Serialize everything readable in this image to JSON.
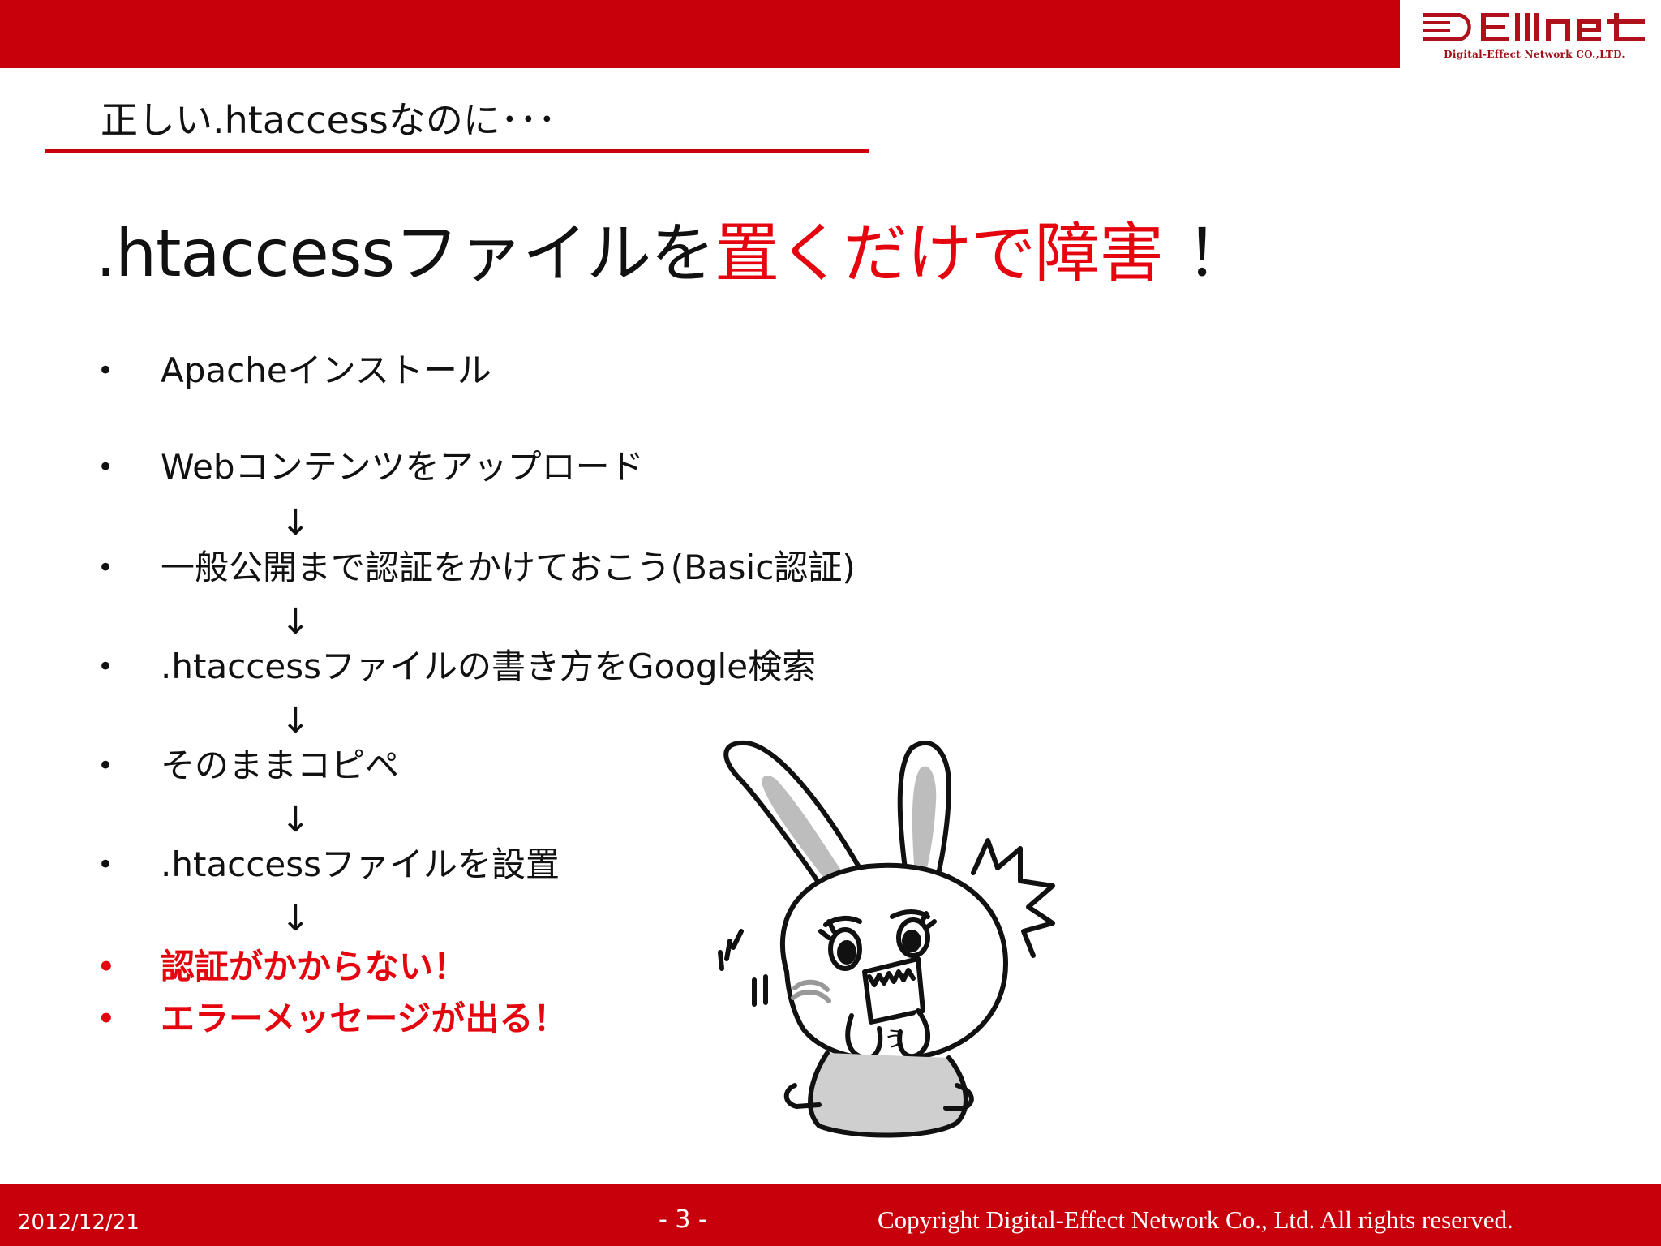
{
  "header": {
    "logo_text": "DEllNET",
    "logo_caption": "Digital-Effect Network CO.,LTD."
  },
  "section_heading": "正しい.htaccessなのに･･･",
  "title": {
    "part1": ".htaccessファイルを",
    "highlight": "置くだけで障害",
    "tail": "！"
  },
  "bullets": [
    {
      "marker": "•",
      "text": "Apacheインストール"
    },
    {
      "marker": "•",
      "text": "Webコンテンツをアップロード"
    },
    {
      "marker": "•",
      "text": "一般公開まで認証をかけておこう(Basic認証)"
    },
    {
      "marker": "•",
      "text": ".htaccessファイルの書き方をGoogle検索"
    },
    {
      "marker": "•",
      "text": "そのままコピペ"
    },
    {
      "marker": "•",
      "text": ".htaccessファイルを設置"
    },
    {
      "marker": "•",
      "text": "認証がかからない！"
    },
    {
      "marker": "•",
      "text": "エラーメッセージが出る！"
    }
  ],
  "flow_arrow": "↓",
  "illustration": {
    "mouth_text": "う"
  },
  "footer": {
    "date": "2012/12/21",
    "page": "- 3 -",
    "copyright": "Copyright Digital-Effect Network Co., Ltd. All rights reserved."
  },
  "colors": {
    "brand_red": "#c8000b",
    "highlight_red": "#e5050f"
  }
}
